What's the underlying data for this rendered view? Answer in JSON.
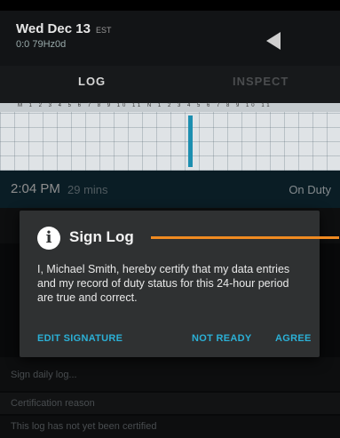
{
  "header": {
    "date": "Wed Dec 13",
    "timezone": "EST",
    "subtitle": "0:0 79Hz0d"
  },
  "tabs": [
    {
      "label": "LOG"
    },
    {
      "label": "INSPECT"
    }
  ],
  "graph": {
    "ticks": "M 1 2 3 4 5 6 7 8 9 10 11 N 1 2 3 4 5 6 7 8 9 10 11"
  },
  "event": {
    "time": "2:04 PM",
    "duration": "29 mins",
    "status": "On Duty"
  },
  "dim_rows": [
    {
      "label": "Sign daily log..."
    },
    {
      "label": "Certification reason"
    },
    {
      "label": "This log has not yet been certified"
    }
  ],
  "dialog": {
    "title": "Sign Log",
    "body": "I, Michael Smith, hereby certify that my data entries and my record of duty status for this 24-hour period are true and correct.",
    "buttons": {
      "edit": "EDIT SIGNATURE",
      "not_ready": "NOT READY",
      "agree": "AGREE"
    },
    "info_glyph": "i"
  },
  "colors": {
    "accent": "#2aa8c9",
    "pointer": "#f08a21",
    "dialog_bg": "#2f3132"
  }
}
